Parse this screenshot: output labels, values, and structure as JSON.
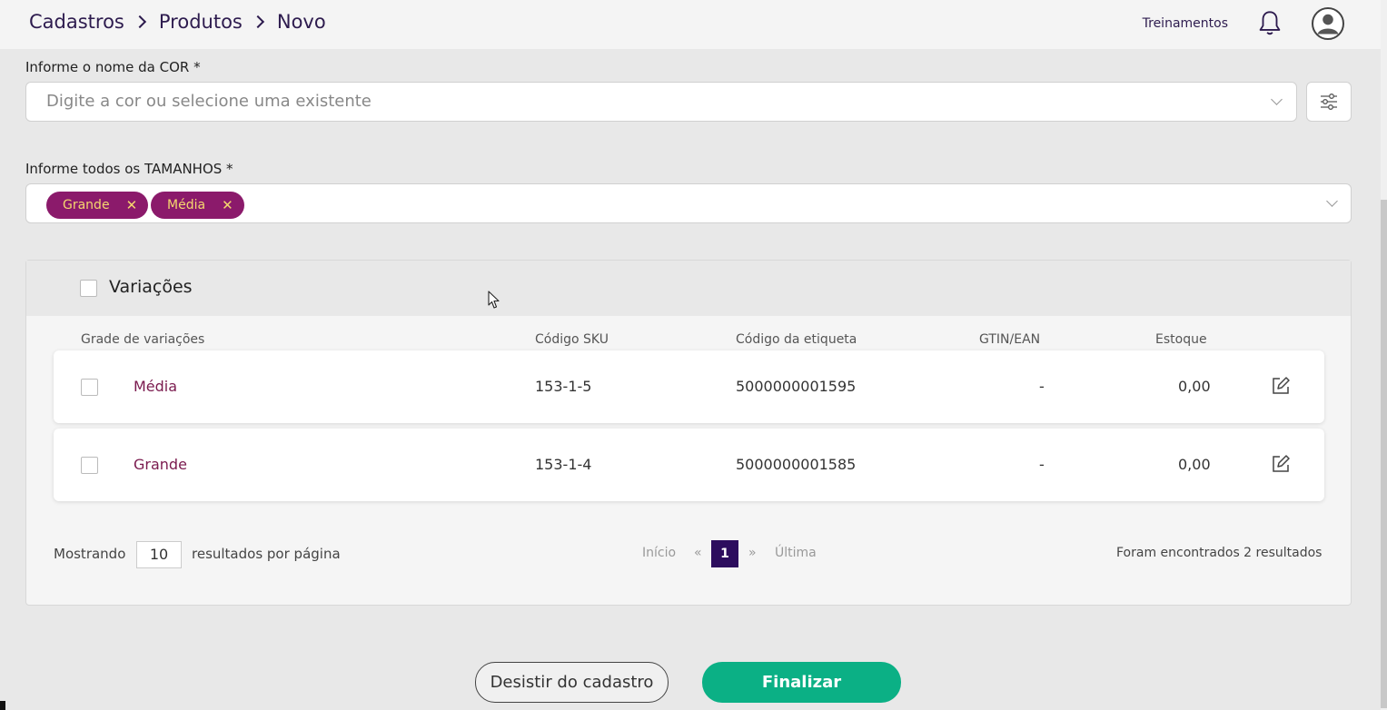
{
  "header": {
    "breadcrumb": [
      "Cadastros",
      "Produtos",
      "Novo"
    ],
    "training_link": "Treinamentos",
    "icons": [
      "bell-icon",
      "user-avatar-icon"
    ]
  },
  "color_field": {
    "label": "Informe o nome da COR *",
    "placeholder": "Digite a cor ou selecione uma existente"
  },
  "sizes_field": {
    "label": "Informe todos os TAMANHOS *",
    "chips": [
      "Grande",
      "Média"
    ]
  },
  "variations": {
    "title": "Variações",
    "columns": [
      "Grade de variações",
      "Código SKU",
      "Código da etiqueta",
      "GTIN/EAN",
      "Estoque"
    ],
    "rows": [
      {
        "name": "Média",
        "sku": "153-1-5",
        "label_code": "5000000001595",
        "gtin": "-",
        "stock": "0,00"
      },
      {
        "name": "Grande",
        "sku": "153-1-4",
        "label_code": "5000000001585",
        "gtin": "-",
        "stock": "0,00"
      }
    ],
    "footer": {
      "showing": "Mostrando",
      "per_page": "10",
      "per_page_suffix": "resultados por página",
      "first": "Início",
      "prev": "«",
      "current_page": "1",
      "next": "»",
      "last": "Última",
      "results": "Foram encontrados 2 resultados"
    }
  },
  "actions": {
    "cancel": "Desistir do cadastro",
    "finish": "Finalizar"
  },
  "colors": {
    "brand_dark": "#2d1b4e",
    "chip_bg": "#8b1a6b",
    "chip_text": "#f5d76e",
    "finish_bg": "#0bb085",
    "page_active": "#2d0d5e"
  }
}
